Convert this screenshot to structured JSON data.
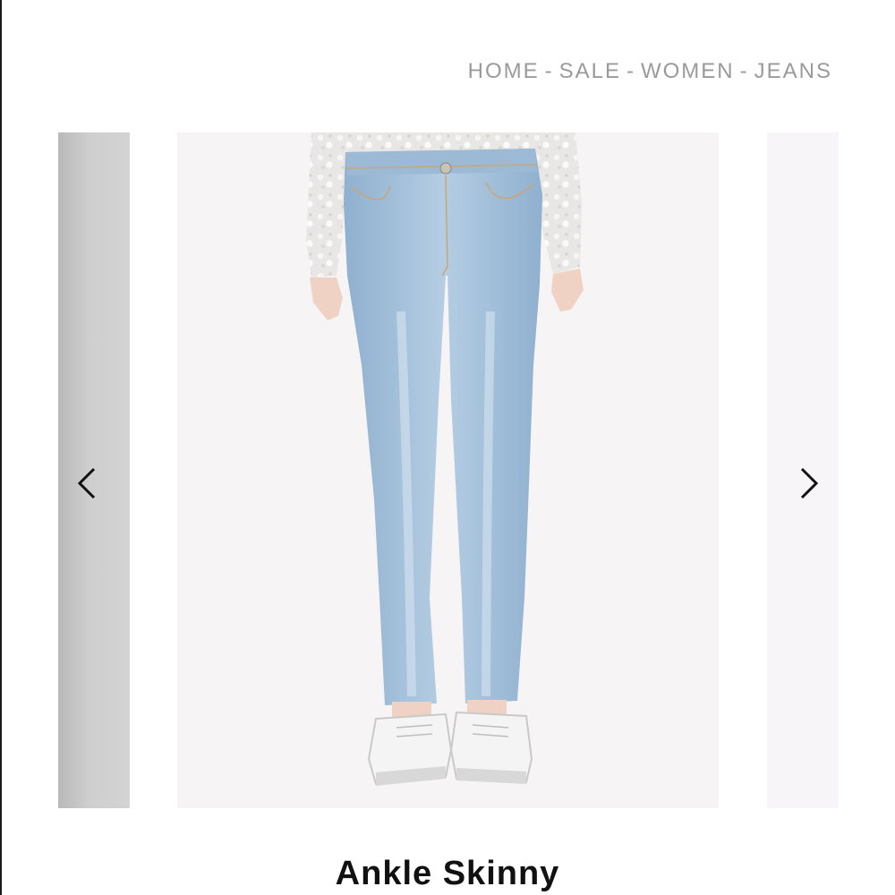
{
  "breadcrumb": {
    "items": [
      "HOME",
      "SALE",
      "WOMEN",
      "JEANS"
    ],
    "separator": "-"
  },
  "gallery": {
    "prev_icon": "chevron-left-icon",
    "next_icon": "chevron-right-icon",
    "image_alt": "Light wash skinny jeans with white sneakers"
  },
  "product": {
    "title": "Ankle Skinny"
  },
  "colors": {
    "breadcrumb": "#9a9a9a",
    "title": "#111111",
    "denim": "#a8c3dc"
  }
}
